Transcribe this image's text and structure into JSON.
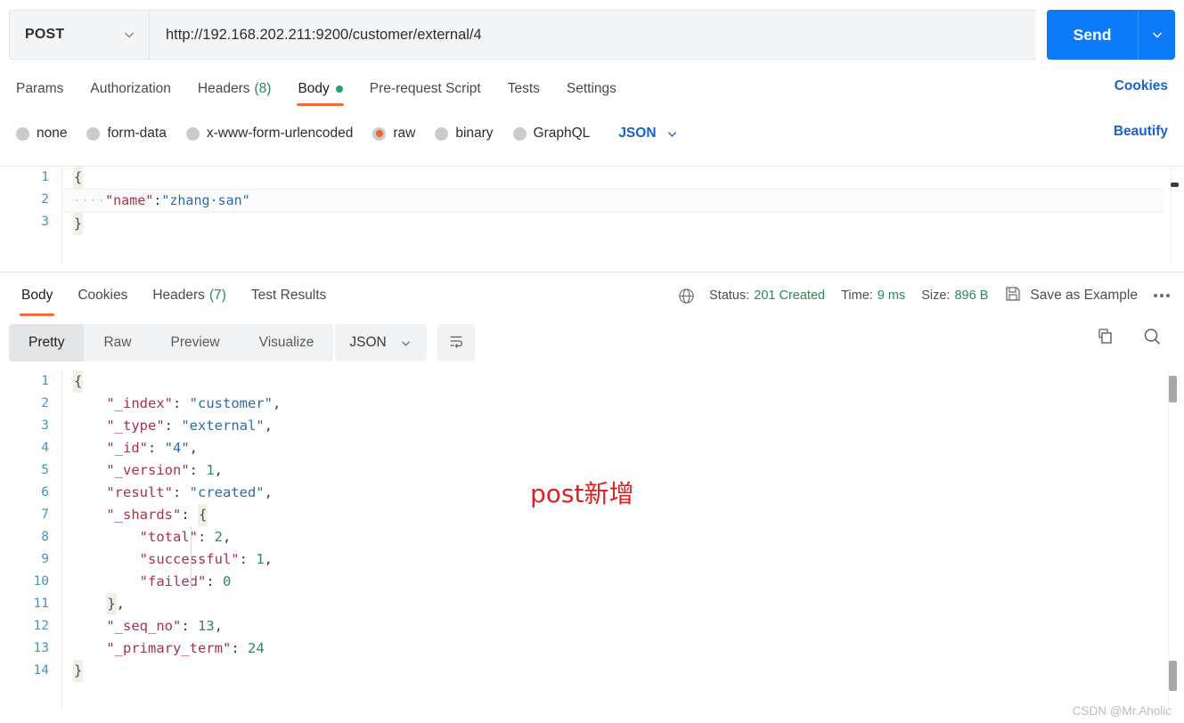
{
  "request": {
    "method": "POST",
    "url": "http://192.168.202.211:9200/customer/external/4",
    "send_label": "Send",
    "tabs": [
      {
        "label": "Params",
        "active": false,
        "count": ""
      },
      {
        "label": "Authorization",
        "active": false,
        "count": ""
      },
      {
        "label": "Headers",
        "active": false,
        "count": "(8)"
      },
      {
        "label": "Body",
        "active": true,
        "count": ""
      },
      {
        "label": "Pre-request Script",
        "active": false,
        "count": ""
      },
      {
        "label": "Tests",
        "active": false,
        "count": ""
      },
      {
        "label": "Settings",
        "active": false,
        "count": ""
      }
    ],
    "cookies_link": "Cookies",
    "beautify_link": "Beautify",
    "body_types": [
      {
        "label": "none",
        "selected": false
      },
      {
        "label": "form-data",
        "selected": false
      },
      {
        "label": "x-www-form-urlencoded",
        "selected": false
      },
      {
        "label": "raw",
        "selected": true
      },
      {
        "label": "binary",
        "selected": false
      },
      {
        "label": "GraphQL",
        "selected": false
      }
    ],
    "raw_format": "JSON",
    "body_lines": [
      {
        "no": "1",
        "text": "{"
      },
      {
        "no": "2",
        "text": "    \"name\":\"zhang san\""
      },
      {
        "no": "3",
        "text": "}"
      }
    ],
    "body_json": {
      "name": "zhang san"
    }
  },
  "response": {
    "tabs": [
      {
        "label": "Body",
        "active": true,
        "count": ""
      },
      {
        "label": "Cookies",
        "active": false,
        "count": ""
      },
      {
        "label": "Headers",
        "active": false,
        "count": "(7)"
      },
      {
        "label": "Test Results",
        "active": false,
        "count": ""
      }
    ],
    "status_label": "Status:",
    "status_value": "201 Created",
    "time_label": "Time:",
    "time_value": "9 ms",
    "size_label": "Size:",
    "size_value": "896 B",
    "save_as_example": "Save as Example",
    "format_tabs": [
      {
        "label": "Pretty",
        "active": true
      },
      {
        "label": "Raw",
        "active": false
      },
      {
        "label": "Preview",
        "active": false
      },
      {
        "label": "Visualize",
        "active": false
      }
    ],
    "format_type": "JSON",
    "body_lines": [
      {
        "no": "1",
        "text": "{"
      },
      {
        "no": "2",
        "text": "    \"_index\": \"customer\","
      },
      {
        "no": "3",
        "text": "    \"_type\": \"external\","
      },
      {
        "no": "4",
        "text": "    \"_id\": \"4\","
      },
      {
        "no": "5",
        "text": "    \"_version\": 1,"
      },
      {
        "no": "6",
        "text": "    \"result\": \"created\","
      },
      {
        "no": "7",
        "text": "    \"_shards\": {"
      },
      {
        "no": "8",
        "text": "        \"total\": 2,"
      },
      {
        "no": "9",
        "text": "        \"successful\": 1,"
      },
      {
        "no": "10",
        "text": "        \"failed\": 0"
      },
      {
        "no": "11",
        "text": "    },"
      },
      {
        "no": "12",
        "text": "    \"_seq_no\": 13,"
      },
      {
        "no": "13",
        "text": "    \"_primary_term\": 24"
      },
      {
        "no": "14",
        "text": "}"
      }
    ],
    "body_json": {
      "_index": "customer",
      "_type": "external",
      "_id": "4",
      "_version": 1,
      "result": "created",
      "_shards": {
        "total": 2,
        "successful": 1,
        "failed": 0
      },
      "_seq_no": 13,
      "_primary_term": 24
    }
  },
  "annotation": "post新增",
  "watermark": "CSDN @Mr.Aholic",
  "colors": {
    "accent_orange": "#f26b3a",
    "send_blue": "#0d7bf7",
    "link_blue": "#1b61c9",
    "status_green": "#2a8a5a",
    "annotation_red": "#e02020",
    "json_key": "#a8324a",
    "json_string": "#2e6ca8",
    "json_number": "#2a8a5a"
  }
}
